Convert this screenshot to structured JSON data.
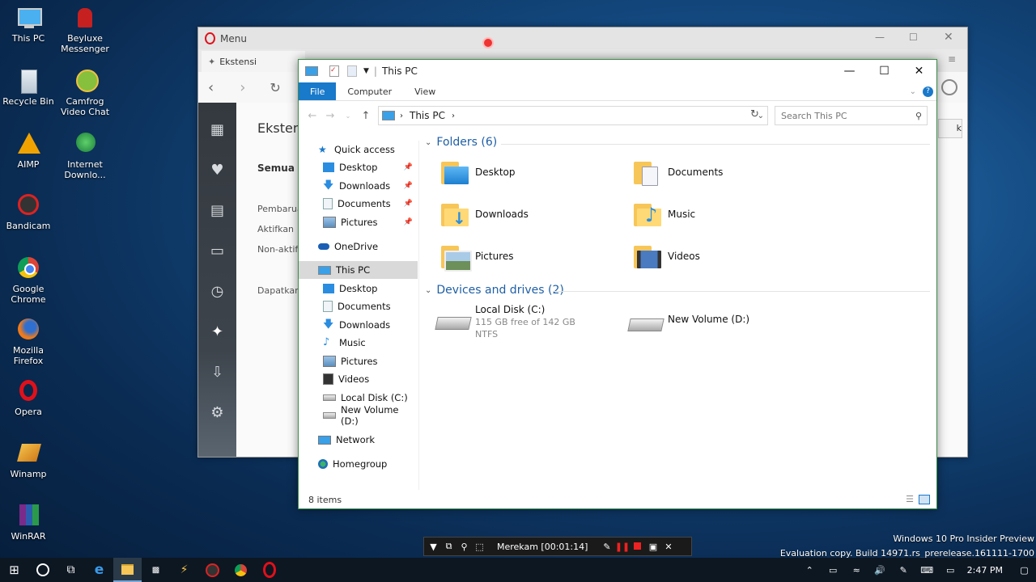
{
  "desktop": {
    "icons": [
      {
        "name": "This PC"
      },
      {
        "name": "Beyluxe Messenger"
      },
      {
        "name": "Recycle Bin"
      },
      {
        "name": "Camfrog Video Chat"
      },
      {
        "name": "AIMP"
      },
      {
        "name": "Internet Downlo..."
      },
      {
        "name": "Bandicam"
      },
      {
        "name": "Google Chrome"
      },
      {
        "name": "Mozilla Firefox"
      },
      {
        "name": "Opera"
      },
      {
        "name": "Winamp"
      },
      {
        "name": "WinRAR"
      }
    ],
    "watermark_line1": "Windows 10 Pro Insider Preview",
    "watermark_line2": "Evaluation copy. Build 14971.rs_prerelease.161111-1700"
  },
  "opera": {
    "menu_label": "Menu",
    "tab_label": "Ekstensi",
    "page_title": "Eksten",
    "filter_all": "Semua",
    "filter_update": "Pembarua",
    "filter_enabled": "Aktifkan",
    "filter_disabled": "Non-aktif",
    "get_more": "Dapatkan",
    "side_button": "k"
  },
  "explorer": {
    "title": "This PC",
    "ribbon_tabs": [
      "File",
      "Computer",
      "View"
    ],
    "address": "This PC",
    "search_placeholder": "Search This PC",
    "nav": {
      "quick_access": "Quick access",
      "qa_items": [
        "Desktop",
        "Downloads",
        "Documents",
        "Pictures"
      ],
      "onedrive": "OneDrive",
      "this_pc": "This PC",
      "pc_items": [
        "Desktop",
        "Documents",
        "Downloads",
        "Music",
        "Pictures",
        "Videos",
        "Local Disk (C:)",
        "New Volume (D:)"
      ],
      "network": "Network",
      "homegroup": "Homegroup"
    },
    "folders_header": "Folders (6)",
    "folders": [
      "Desktop",
      "Documents",
      "Downloads",
      "Music",
      "Pictures",
      "Videos"
    ],
    "drives_header": "Devices and drives (2)",
    "drives": [
      {
        "name": "Local Disk (C:)",
        "free": "115 GB free of 142 GB",
        "fs": "NTFS",
        "used_fraction": 0.19
      },
      {
        "name": "New Volume (D:)"
      }
    ],
    "status": "8 items"
  },
  "recorder": {
    "label": "Merekam [00:01:14]"
  },
  "taskbar": {
    "time": "2:47 PM"
  },
  "colors": {
    "accent": "#1979ca",
    "folder": "#f7c659",
    "desktop_bg": "#13487e"
  }
}
